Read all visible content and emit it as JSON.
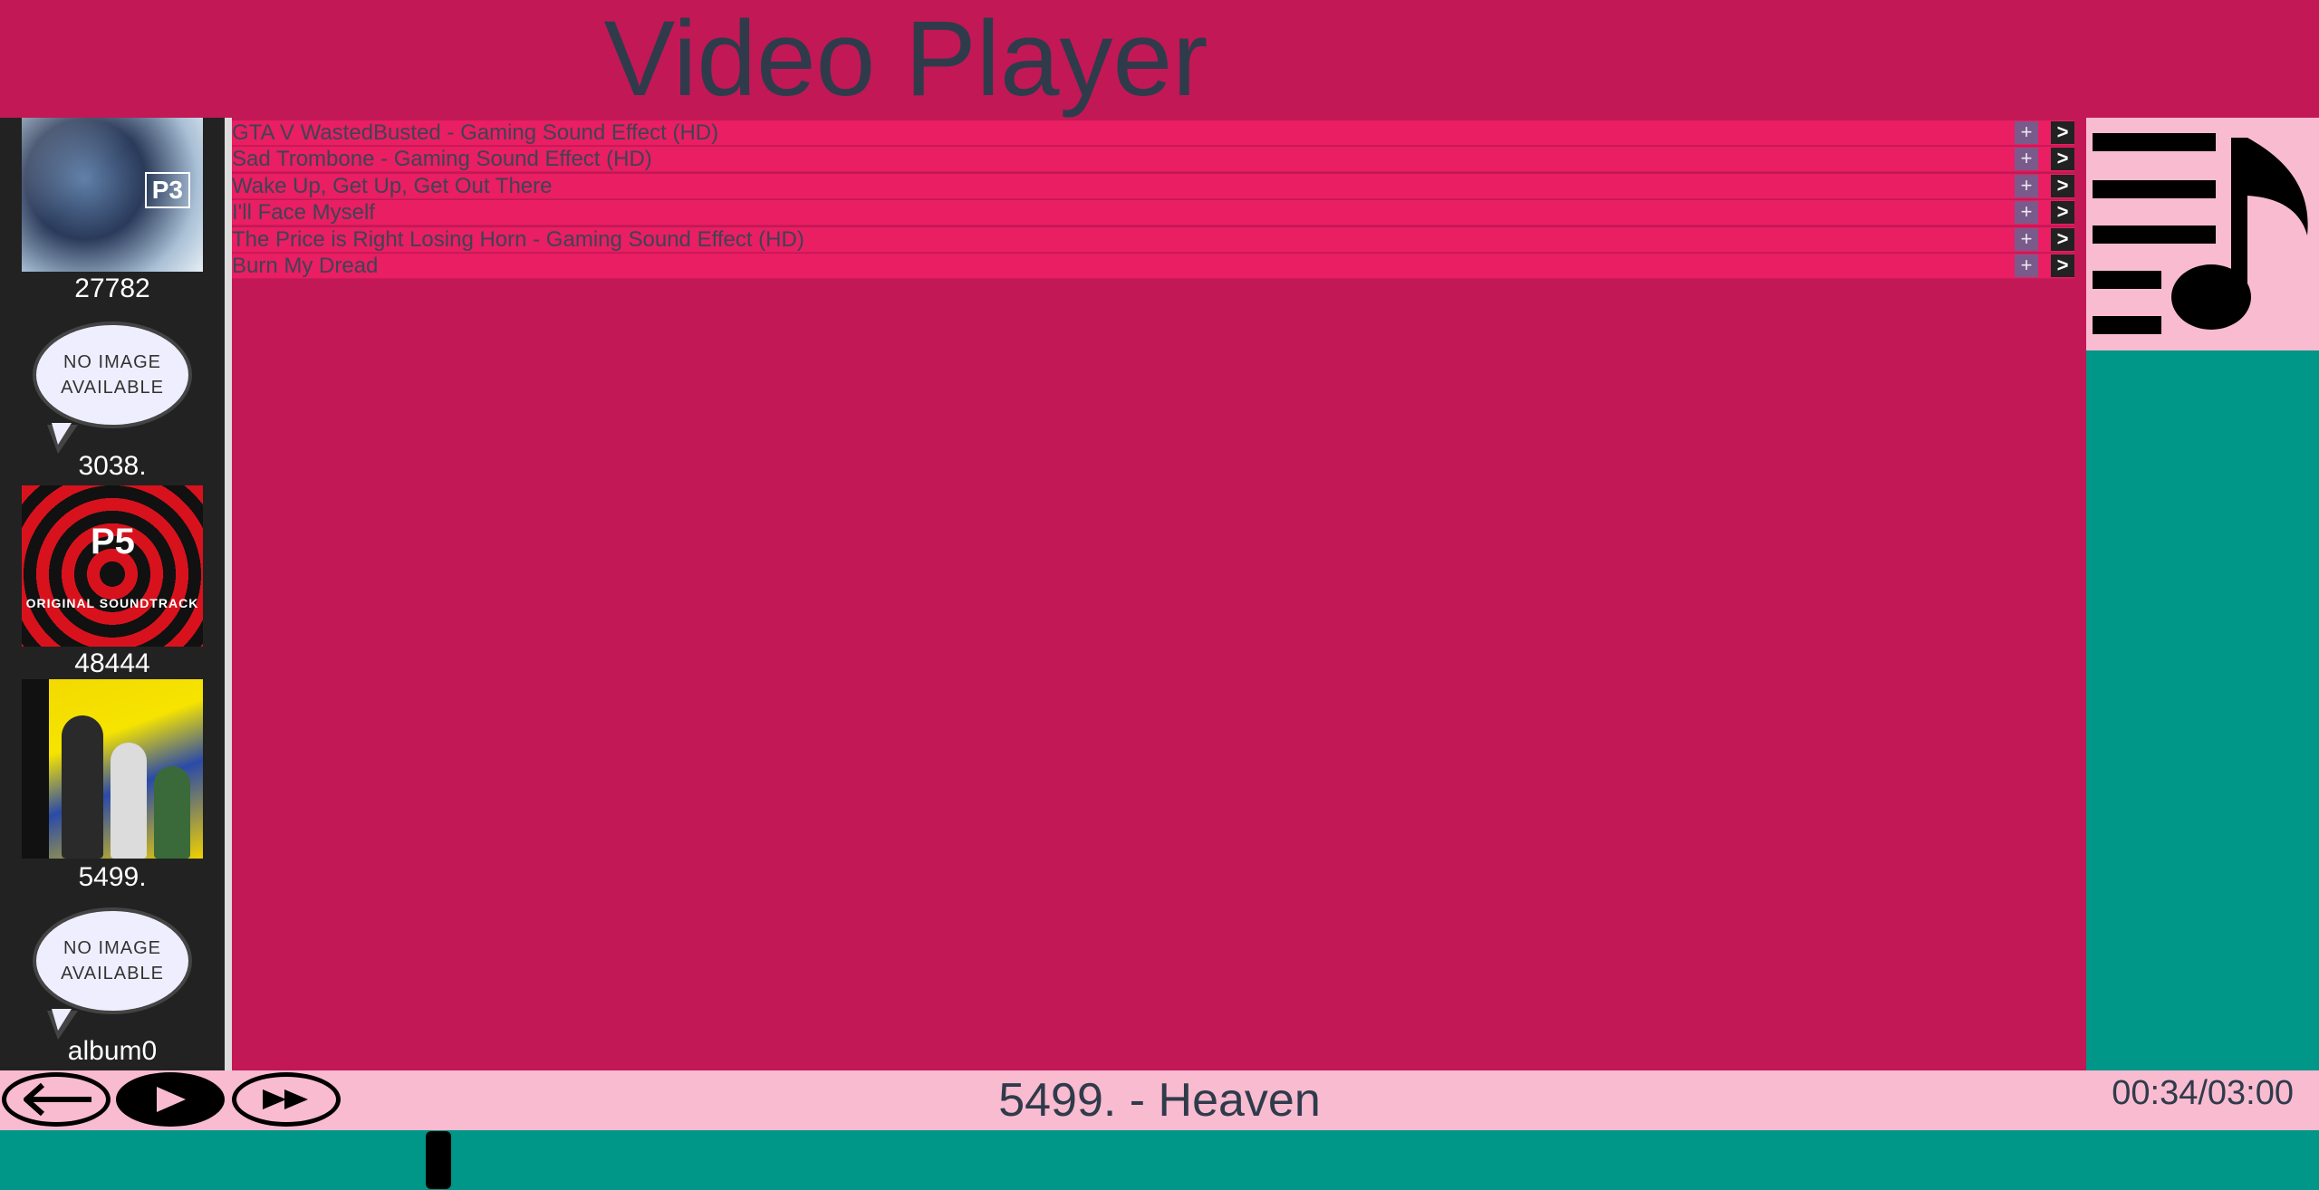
{
  "header": {
    "title": "Video Player"
  },
  "sidebar": {
    "albums": [
      {
        "label": "27782",
        "cover": "persona-3-soundtrack-cover",
        "cover_text": "P3"
      },
      {
        "label": "3038.",
        "cover": "no-image",
        "cover_text": "NO IMAGE AVAILABLE"
      },
      {
        "label": "48444",
        "cover": "persona-5-soundtrack-cover",
        "cover_text": "ORIGINAL SOUNDTRACK"
      },
      {
        "label": "5499.",
        "cover": "persona-4-soundtrack-cover",
        "cover_text": ""
      },
      {
        "label": "album0",
        "cover": "no-image",
        "cover_text": "NO IMAGE AVAILABLE"
      }
    ]
  },
  "playlist": {
    "add_label": "+",
    "play_label": ">",
    "items": [
      {
        "title": "GTA V WastedBusted - Gaming Sound Effect (HD)"
      },
      {
        "title": "Sad Trombone - Gaming Sound Effect (HD)"
      },
      {
        "title": "Wake Up, Get Up, Get Out There"
      },
      {
        "title": "I'll Face Myself"
      },
      {
        "title": "The Price is Right Losing Horn - Gaming Sound Effect (HD)"
      },
      {
        "title": "Burn My Dread"
      }
    ]
  },
  "queue_panel": {
    "icon": "playlist-music-icon"
  },
  "controls": {
    "prev_icon": "back-arrow-icon",
    "play_icon": "play-icon",
    "next_icon": "fast-forward-icon",
    "now_playing": "5499. - Heaven",
    "time": "00:34/03:00"
  },
  "progress": {
    "fraction": 0.1889
  },
  "colors": {
    "main_bg": "#c21856",
    "row_bg": "#e91e63",
    "sidebar_bg": "#222222",
    "panel_teal": "#009688",
    "panel_pink": "#f8bbd0",
    "title_text": "#2f3b4b"
  }
}
